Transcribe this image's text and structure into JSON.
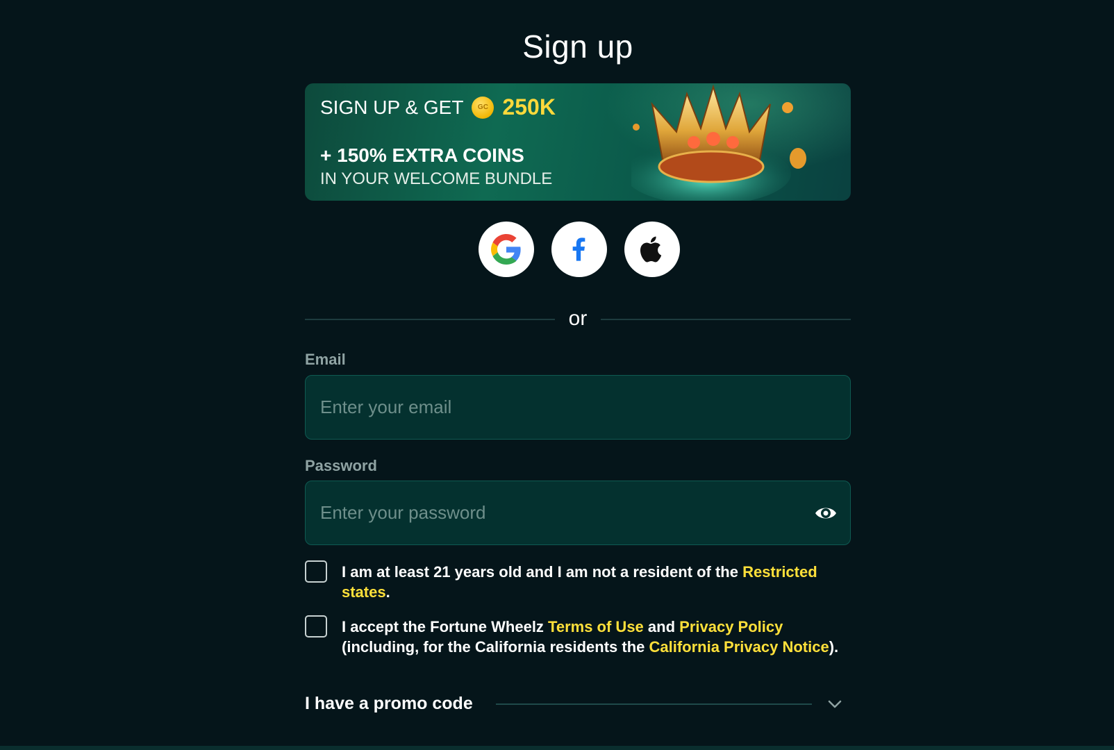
{
  "page": {
    "title": "Sign up"
  },
  "banner": {
    "line1_prefix": "SIGN UP & GET",
    "coin_label": "GC",
    "amount": "250K",
    "line2": "+ 150% EXTRA COINS",
    "line3": "IN YOUR WELCOME BUNDLE",
    "accent_color": "#ffd93b"
  },
  "social": [
    {
      "name": "google",
      "icon": "google-icon"
    },
    {
      "name": "facebook",
      "icon": "facebook-icon"
    },
    {
      "name": "apple",
      "icon": "apple-icon"
    }
  ],
  "divider": {
    "text": "or"
  },
  "form": {
    "email": {
      "label": "Email",
      "placeholder": "Enter your email",
      "value": ""
    },
    "password": {
      "label": "Password",
      "placeholder": "Enter your password",
      "value": "",
      "toggle_icon": "eye-icon"
    }
  },
  "consents": {
    "age": {
      "checked": false,
      "text": "I am at least 21 years old and I am not a resident of the ",
      "link": "Restricted states",
      "suffix": "."
    },
    "terms": {
      "checked": false,
      "t1": "I accept the Fortune Wheelz ",
      "link1": "Terms of Use",
      "t2": " and ",
      "link2": "Privacy Policy",
      "t3": " (including, for the California residents the ",
      "link3": "California Privacy Notice",
      "t4": ")."
    }
  },
  "promo": {
    "label": "I have a promo code",
    "icon": "chevron-down-icon"
  },
  "colors": {
    "background": "#05151a",
    "field_bg": "#04312f",
    "link": "#ffe03a"
  }
}
